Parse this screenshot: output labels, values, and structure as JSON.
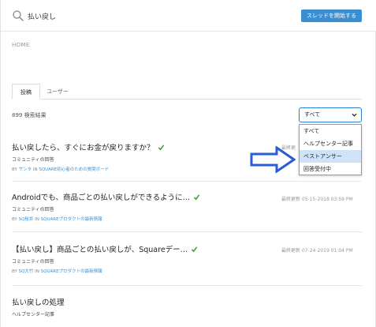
{
  "search": {
    "query": "払い戻し"
  },
  "header": {
    "start_thread_label": "スレッドを開始する"
  },
  "breadcrumb": "HOME",
  "tabs": [
    {
      "label": "投稿"
    },
    {
      "label": "ユーザー"
    }
  ],
  "results": {
    "count_text": "899 検索結果"
  },
  "filter": {
    "selected": "すべて",
    "options": [
      "すべて",
      "ヘルプセンター記事",
      "ベストアンサー",
      "回答受付中"
    ],
    "highlighted": "ベストアンサー"
  },
  "posts": [
    {
      "title": "払い戻したら、すぐにお金が戻りますか？",
      "type": "コミュニティの回答",
      "by": "BY",
      "author": "サンタ",
      "in": "IN",
      "board": "SQUARE初心者のための質問ボード",
      "date": "最終更",
      "solved": true
    },
    {
      "title": "Androidでも、商品ごとの払い戻しができるように…",
      "type": "コミュニティの回答",
      "by": "BY",
      "author": "SQ桜井",
      "in": "IN",
      "board": "SQUAREプロダクトの最新情報",
      "date": "最終更新 05-15-2018 03:59 PM",
      "solved": true
    },
    {
      "title": "【払い戻し】商品ごとの払い戻しが、Squareデー…",
      "type": "コミュニティの回答",
      "by": "BY",
      "author": "SQ大竹",
      "in": "IN",
      "board": "SQUAREプロダクトの最新情報",
      "date": "最終更新 07-24-2019 01:04 PM",
      "solved": true
    },
    {
      "title": "払い戻しの処理",
      "type": "ヘルプセンター記事"
    }
  ],
  "colors": {
    "accent": "#3a8fd3",
    "check": "#3aa635",
    "arrow": "#2a5cd6"
  }
}
